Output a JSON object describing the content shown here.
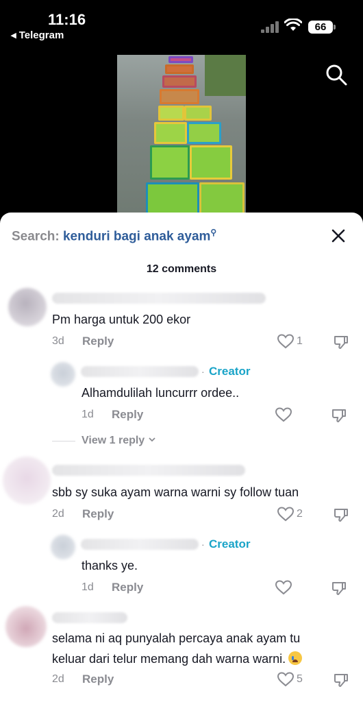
{
  "status": {
    "time": "11:16",
    "back_app": "◂ Telegram",
    "battery": "66"
  },
  "search": {
    "prefix": "Search:",
    "query": "kenduri bagi anak ayam"
  },
  "comments_count": "12 comments",
  "comments": [
    {
      "text": "Pm harga untuk 200 ekor",
      "time": "3d",
      "reply": "Reply",
      "likes": "1"
    },
    {
      "creator_label": "Creator",
      "creator_dot": "·",
      "text": "Alhamdulilah luncurrr ordee..",
      "time": "1d",
      "reply": "Reply"
    },
    {
      "view_reply": "View 1 reply"
    },
    {
      "text": "sbb sy suka ayam warna warni sy follow tuan",
      "time": "2d",
      "reply": "Reply",
      "likes": "2"
    },
    {
      "creator_label": "Creator",
      "creator_dot": "·",
      "text": "thanks ye.",
      "time": "1d",
      "reply": "Reply"
    },
    {
      "text_line1": "selama ni aq punyalah percaya anak ayam tu",
      "text_line2": "keluar dari telur memang dah warna warni.",
      "time": "2d",
      "reply": "Reply",
      "likes": "5"
    }
  ]
}
